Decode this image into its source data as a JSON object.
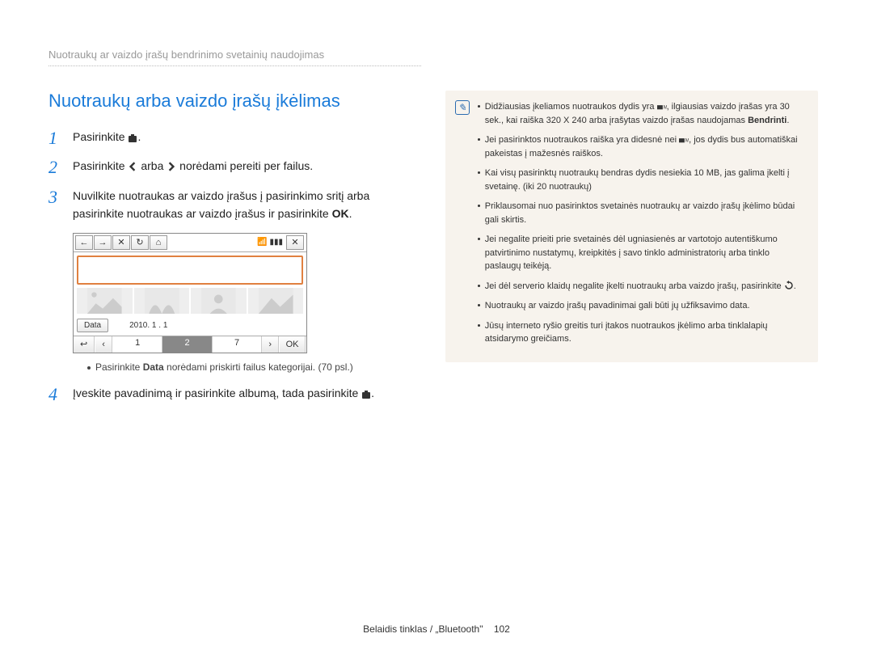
{
  "breadcrumb": "Nuotraukų ar vaizdo įrašų bendrinimo svetainių naudojimas",
  "heading": "Nuotraukų arba vaizdo įrašų įkėlimas",
  "steps": {
    "s1": {
      "num": "1",
      "text_a": "Pasirinkite ",
      "text_b": "."
    },
    "s2": {
      "num": "2",
      "text_a": "Pasirinkite ",
      "text_mid": " arba ",
      "text_b": " norėdami pereiti per failus."
    },
    "s3": {
      "num": "3",
      "text": "Nuvilkite nuotraukas ar vaizdo įrašus į pasirinkimo sritį arba pasirinkite nuotraukas ar vaizdo įrašus ir pasirinkite ",
      "ok": "OK",
      "tail": "."
    },
    "s4": {
      "num": "4",
      "text_a": "Įveskite pavadinimą ir pasirinkite albumą, tada pasirinkite ",
      "tail": "."
    }
  },
  "ui": {
    "data_btn": "Data",
    "date": "2010. 1 . 1",
    "pages": [
      "1",
      "2",
      "7"
    ],
    "ok": "OK"
  },
  "sub_bullet": {
    "text_a": "Pasirinkite ",
    "bold": "Data",
    "text_b": " norėdami priskirti failus kategorijai. (70 psl.)"
  },
  "notes": {
    "n0_a": "Didžiausias įkeliamos nuotraukos dydis yra ",
    "n0_b": ", ilgiausias vaizdo įrašas yra 30 sek., kai raiška 320 X 240 arba įrašytas vaizdo įrašas naudojamas ",
    "n0_bold": "Bendrinti",
    "n0_tail": ".",
    "n1_a": "Jei pasirinktos nuotraukos raiška yra didesnė nei ",
    "n1_b": ", jos dydis bus automatiškai pakeistas į mažesnės raiškos.",
    "n2": "Kai visų pasirinktų nuotraukų bendras dydis nesiekia 10 MB, jas galima įkelti į svetainę. (iki 20 nuotraukų)",
    "n3": "Priklausomai nuo pasirinktos svetainės nuotraukų ar vaizdo įrašų įkėlimo būdai gali skirtis.",
    "n4": "Jei negalite prieiti prie svetainės dėl ugniasienės ar vartotojo autentiškumo patvirtinimo nustatymų, kreipkitės į savo tinklo administratorių arba tinklo paslaugų teikėją.",
    "n5_a": "Jei dėl serverio klaidų negalite įkelti nuotraukų arba vaizdo įrašų, pasirinkite ",
    "n5_b": ".",
    "n6": "Nuotraukų ar vaizdo įrašų pavadinimai gali būti jų užfiksavimo data.",
    "n7": "Jūsų interneto ryšio greitis turi įtakos nuotraukos įkėlimo arba tinklalapių atsidarymo greičiams."
  },
  "footer": {
    "section": "Belaidis tinklas / „Bluetooth\"",
    "page": "102"
  }
}
